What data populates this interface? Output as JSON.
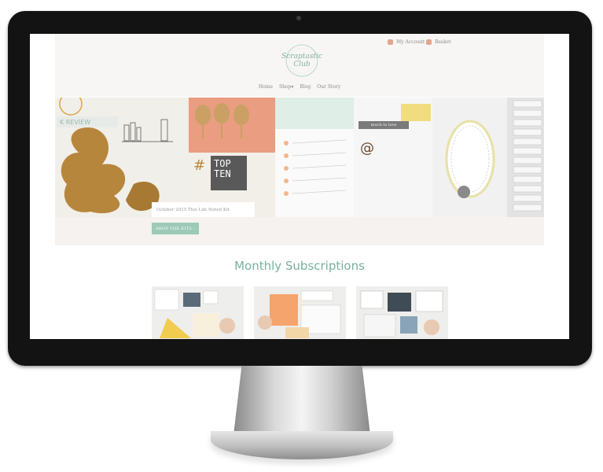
{
  "site": {
    "account_label": "My Account",
    "basket_label": "Basket",
    "logo_text": "Scraptastic Club",
    "nav": [
      "Home",
      "Shop▾",
      "Blog",
      "Our Story"
    ],
    "hero": {
      "caption": "October 2015 This Life Noted Kit",
      "cta": "SHOP THE KITS ›",
      "left_card_text": "K REVIEW",
      "badge_text": "TOP TEN",
      "tag_text": "much to love"
    },
    "section_title": "Monthly Subscriptions",
    "thumbnails": [
      "subscription-kit-1",
      "subscription-kit-2",
      "subscription-kit-3"
    ]
  },
  "colors": {
    "accent": "#7ab09e",
    "button": "#9cc9b8",
    "header_bg": "#f8f6f4",
    "icon": "#e3a58c"
  }
}
